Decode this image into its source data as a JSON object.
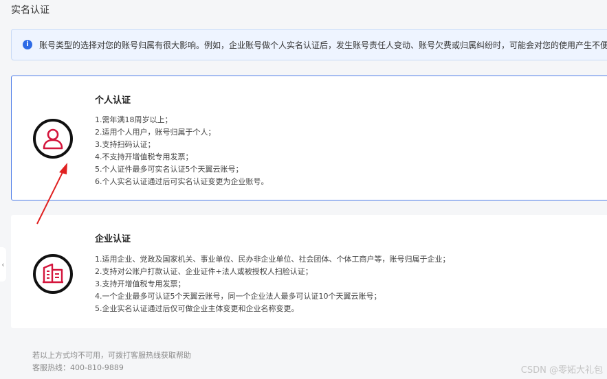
{
  "page": {
    "title": "实名认证"
  },
  "notice": {
    "icon": "info-icon",
    "text": "账号类型的选择对您的账号归属有很大影响。例如，企业账号做个人实名认证后，发生账号责任人变动、账号欠费或归属纠纷时，可能会对您的使用产生不便"
  },
  "personal": {
    "title": "个人认证",
    "icon": "person-icon",
    "items": [
      "1.需年满18周岁以上；",
      "2.适用个人用户，账号归属于个人；",
      "3.支持扫码认证；",
      "4.不支持开增值税专用发票；",
      "5.个人证件最多可实名认证5个天翼云账号；",
      "6.个人实名认证通过后可实名认证变更为企业账号。"
    ]
  },
  "enterprise": {
    "title": "企业认证",
    "icon": "building-icon",
    "items": [
      "1.适用企业、党政及国家机关、事业单位、民办非企业单位、社会团体、个体工商户等，账号归属于企业；",
      "2.支持对公账户打款认证、企业证件+法人或被授权人扫脸认证；",
      "3.支持开增值税专用发票；",
      "4.一个企业最多可认证5个天翼云账号，同一个企业法人最多可认证10个天翼云账号；",
      "5.企业实名认证通过后仅可做企业主体变更和企业名称变更。"
    ]
  },
  "footer": {
    "note": "若以上方式均不可用，可拨打客服热线获取帮助",
    "hotline": "客服热线：400-810-9889"
  },
  "watermark": "CSDN @零妬大礼包",
  "colors": {
    "accent": "#d4153c",
    "selected_border": "#4b7be8",
    "info": "#2e6be6"
  }
}
